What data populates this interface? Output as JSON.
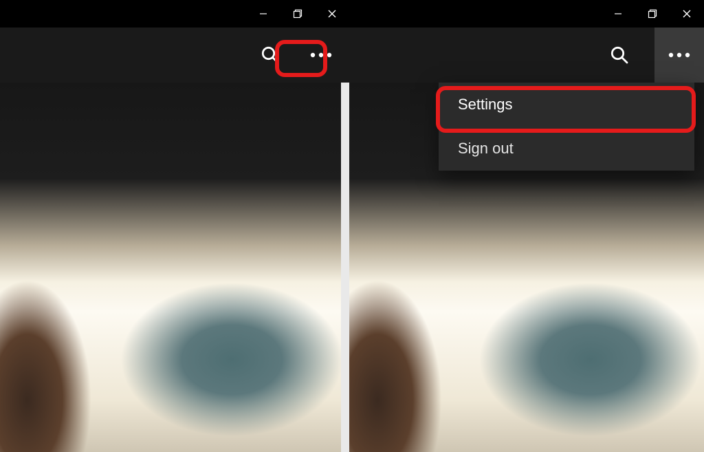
{
  "left": {
    "titlebar": {
      "min": "—",
      "max": "▢",
      "close": "✕"
    },
    "toolbar": {
      "search_icon": "search",
      "more_icon": "more"
    }
  },
  "right": {
    "titlebar": {
      "min": "—",
      "max": "▢",
      "close": "✕"
    },
    "toolbar": {
      "search_icon": "search",
      "more_icon": "more"
    },
    "dropdown": {
      "items": [
        {
          "label": "Settings"
        },
        {
          "label": "Sign out"
        }
      ]
    }
  }
}
